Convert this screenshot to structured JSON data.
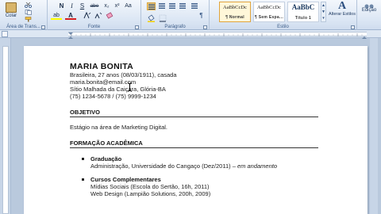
{
  "ribbon": {
    "clipboard": {
      "paste_label": "Colar",
      "group_label": "Área de Trans..."
    },
    "font": {
      "group_label": "Fonte",
      "bold": "N",
      "italic": "I",
      "underline": "S",
      "strike": "abe",
      "subscript": "x₂",
      "superscript": "x²",
      "change_case": "Aa",
      "font_color": "A",
      "highlight": "ab"
    },
    "paragraph": {
      "group_label": "Parágrafo",
      "pilcrow": "¶"
    },
    "styles": {
      "group_label": "Estilo",
      "tiles": [
        {
          "sample": "AaBbCcDc",
          "name": "¶ Normal"
        },
        {
          "sample": "AaBbCcDc",
          "name": "¶ Sem Espa..."
        },
        {
          "sample": "AaBbC",
          "name": "Título 1"
        }
      ],
      "change_styles_label": "Alterar Estilos",
      "change_styles_icon": "A"
    },
    "editing": {
      "label": "Edição"
    }
  },
  "document": {
    "name": "MARIA BONITA",
    "info": [
      "Brasileira, 27 anos (08/03/1911), casada",
      "maria.bonita@email.com",
      "Sítio Malhada da Caiçara, Glória-BA",
      "(75) 1234-5678 / (75) 9999-1234"
    ],
    "objective_title": "OBJETIVO",
    "objective_text": "Estágio na área de Marketing Digital.",
    "education_title": "FORMAÇÃO ACADÊMICA",
    "education": [
      {
        "title": "Graduação",
        "line1_main": "Administração, Universidade do Cangaço (Dez/2011) – ",
        "line1_italic": "em andamento"
      },
      {
        "title": "Cursos Complementares",
        "lines": [
          "Mídias Sociais (Escola do Sertão, 16h, 2011)",
          "Web Design (Lampião Solutions, 200h, 2009)"
        ]
      }
    ]
  },
  "colors": {
    "ribbon_accent": "#2b4e7f",
    "selected_style": "#e0a43c",
    "font_color_bar": "#d62020",
    "highlight_bar": "#ffff00"
  }
}
